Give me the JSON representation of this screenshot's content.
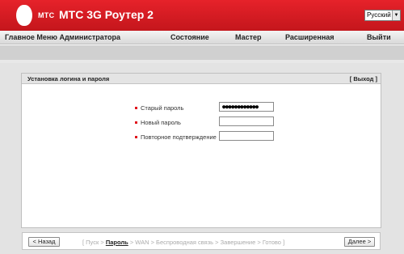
{
  "header": {
    "logo_text": "МТС",
    "app_title": "МТС 3G Роутер 2",
    "language": "Русский"
  },
  "nav": {
    "admin_menu": "Главное Меню Администратора",
    "items": [
      "Состояние",
      "Мастер",
      "Расширенная",
      "Выйти"
    ]
  },
  "panel": {
    "title": "Установка логина и пароля",
    "exit_link": "[ Выход ]",
    "fields": [
      {
        "label": "Старый пароль",
        "value": "●●●●●●●●●●●●"
      },
      {
        "label": "Новый пароль",
        "value": ""
      },
      {
        "label": "Повторное подтверждение",
        "value": ""
      }
    ]
  },
  "footer": {
    "back_button": "< Назад",
    "next_button": "Далее >",
    "steps_open": "[ Пуск > ",
    "step_current": "Пароль",
    "steps_rest": " > WAN > Беспроводная связь > Завершение > Готово ]"
  },
  "colors": {
    "brand_red": "#e6222a",
    "required_marker": "#e0141c"
  }
}
